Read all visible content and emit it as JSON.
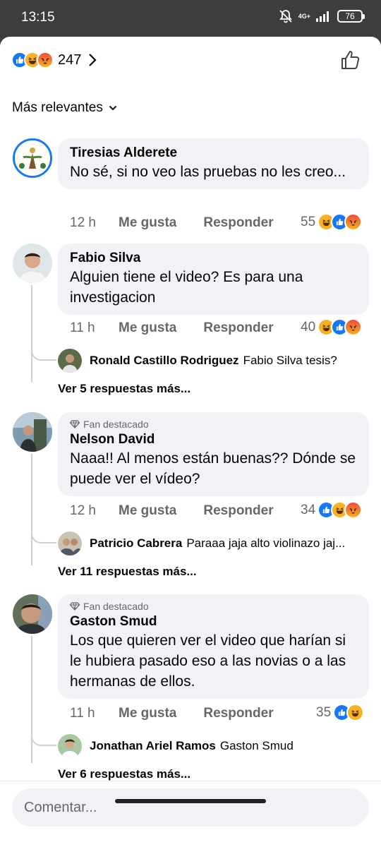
{
  "status": {
    "time": "13:15",
    "network_top": "4G+",
    "battery": "76"
  },
  "header": {
    "reaction_count": "247",
    "reactions": [
      "like",
      "haha",
      "angry"
    ]
  },
  "sort": {
    "label": "Más relevantes"
  },
  "actions": {
    "like": "Me gusta",
    "reply": "Responder"
  },
  "comments": [
    {
      "author": "Tiresias Alderete",
      "badge": "",
      "text": "No sé, si no veo las pruebas no les creo...",
      "time": "12 h",
      "reactions_count": "55",
      "reactions": [
        "haha",
        "like",
        "angry"
      ]
    },
    {
      "author": "Fabio Silva",
      "badge": "",
      "text": "Alguien tiene el video? Es para una investigacion",
      "time": "11 h",
      "reactions_count": "40",
      "reactions": [
        "haha",
        "like",
        "angry"
      ],
      "reply": {
        "author": "Ronald Castillo Rodriguez",
        "text": "Fabio Silva tesis?"
      },
      "more": "Ver 5 respuestas más..."
    },
    {
      "author": "Nelson David",
      "badge": "Fan destacado",
      "text": "Naaa!! Al menos están buenas?? Dónde se puede ver el vídeo?",
      "time": "12 h",
      "reactions_count": "34",
      "reactions": [
        "like",
        "haha",
        "angry"
      ],
      "reply": {
        "author": "Patricio Cabrera",
        "text": "Paraaa jaja alto violinazo jaj..."
      },
      "more": "Ver 11 respuestas más..."
    },
    {
      "author": "Gaston Smud",
      "badge": "Fan destacado",
      "text": "Los que quieren ver el video que harían si le hubiera pasado eso a las novias o a las hermanas de ellos.",
      "time": "11 h",
      "reactions_count": "35",
      "reactions": [
        "like",
        "haha"
      ],
      "reply": {
        "author": "Jonathan Ariel Ramos",
        "text": "Gaston Smud"
      },
      "more": "Ver 6 respuestas más..."
    }
  ],
  "composer": {
    "placeholder": "Comentar..."
  },
  "colors": {
    "like": "#1877f2",
    "haha": "#f7b125",
    "angry": "#f04a3a",
    "bubble": "#f0f2f5",
    "secondary_text": "#65676b"
  }
}
